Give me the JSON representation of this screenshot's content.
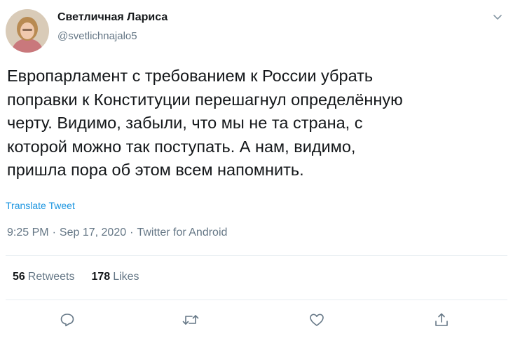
{
  "author": {
    "name": "Светличная Лариса",
    "handle": "@svetlichnajalo5"
  },
  "tweet": {
    "text": "Европарламент с требованием к России убрать\nпоправки к Конституции перешагнул определённую\nчерту. Видимо, забыли, что мы не та страна, с\nкоторой можно так поступать. А нам, видимо,\nпришла пора об этом всем напомнить.",
    "translate_label": "Translate Tweet",
    "time": "9:25 PM",
    "date": "Sep 17, 2020",
    "source": "Twitter for Android",
    "separator": "·"
  },
  "stats": {
    "retweets_count": "56",
    "retweets_label": "Retweets",
    "likes_count": "178",
    "likes_label": "Likes"
  },
  "icons": {
    "caret": "chevron-down-icon",
    "reply": "reply-icon",
    "retweet": "retweet-icon",
    "like": "heart-icon",
    "share": "share-icon"
  },
  "colors": {
    "text": "#14171a",
    "secondary": "#657786",
    "link": "#1b95e0",
    "divider": "#e6ecf0"
  }
}
